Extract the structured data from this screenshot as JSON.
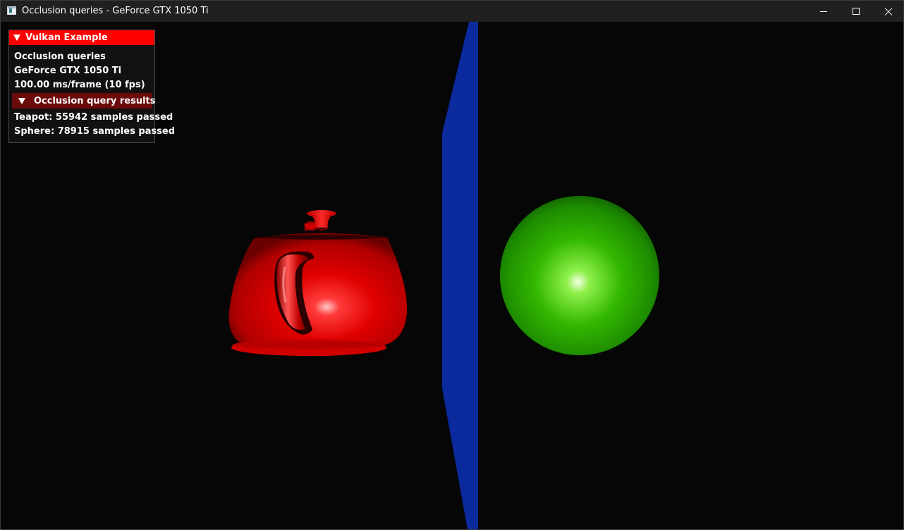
{
  "window": {
    "title": "Occlusion queries - GeForce GTX 1050 Ti"
  },
  "overlay": {
    "header": "Vulkan Example",
    "app_name": "Occlusion queries",
    "device_name": "GeForce GTX 1050 Ti",
    "frame_stats": "100.00 ms/frame (10 fps)",
    "section": {
      "label": "Occlusion query results",
      "results": [
        "Teapot: 55942 samples passed",
        "Sphere: 78915 samples passed"
      ]
    }
  },
  "scene": {
    "teapot_color": "#e00000",
    "sphere_color": "#2db000",
    "occluder_color": "#0a2a9e"
  },
  "colors": {
    "header_accent": "#ff0000",
    "section_header": "#6b0a0a",
    "background": "#060606"
  }
}
